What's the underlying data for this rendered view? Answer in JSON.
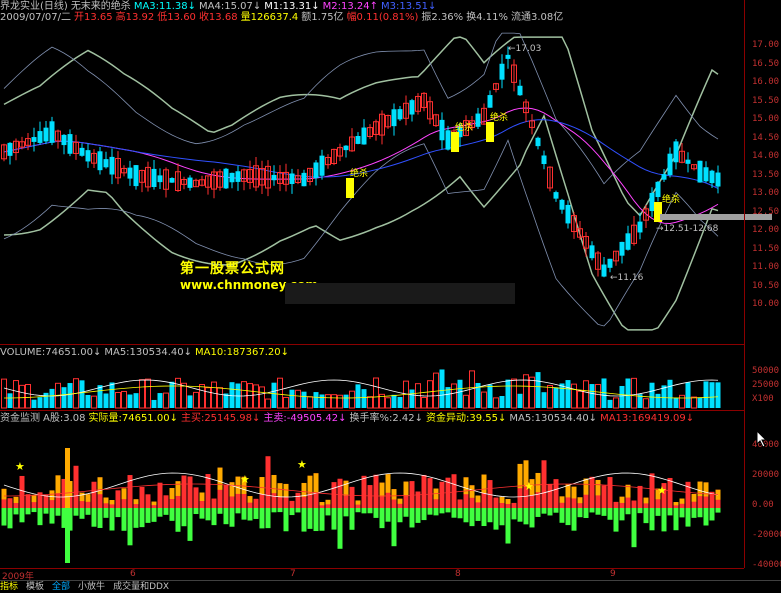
{
  "main_header": {
    "line1": [
      {
        "text": "界龙实业(日线)",
        "color": "#c0c0c0"
      },
      {
        "text": "无末来的绝杀",
        "color": "#c0c0c0"
      },
      {
        "text": "MA3:11.38↓",
        "color": "#00ffff"
      },
      {
        "text": "MA4:15.07↓",
        "color": "#c0c0c0"
      },
      {
        "text": "M1:13.31↓",
        "color": "#ffffff"
      },
      {
        "text": "M2:13.24↑",
        "color": "#ff44ff"
      },
      {
        "text": "M3:13.51↓",
        "color": "#4060ff"
      }
    ],
    "line2": [
      {
        "text": "2009/07/07/二",
        "color": "#c0c0c0"
      },
      {
        "text": "开13.65",
        "color": "#ff3030"
      },
      {
        "text": "高13.92",
        "color": "#ff3030"
      },
      {
        "text": "低13.60",
        "color": "#ff3030"
      },
      {
        "text": "收13.68",
        "color": "#ff3030"
      },
      {
        "text": "量126637.4",
        "color": "#ffff00"
      },
      {
        "text": "额1.75亿",
        "color": "#c0c0c0"
      },
      {
        "text": "幅0.11(0.81%)",
        "color": "#ff3030"
      },
      {
        "text": "振2.36%",
        "color": "#c0c0c0"
      },
      {
        "text": "换4.11%",
        "color": "#c0c0c0"
      },
      {
        "text": "流通3.08亿",
        "color": "#c0c0c0"
      }
    ]
  },
  "price_axis": [
    "17.00",
    "16.50",
    "16.00",
    "15.50",
    "15.00",
    "14.50",
    "14.00",
    "13.50",
    "13.00",
    "12.50",
    "12.00",
    "11.50",
    "11.00",
    "10.50",
    "10.00"
  ],
  "annotations": {
    "high": "17.03",
    "low": "11.16",
    "range": "12.51-12.68",
    "signal": "绝杀"
  },
  "watermark": {
    "line1": "第一股票公式网",
    "line2": "www.chnmoney.com"
  },
  "volume_header": [
    {
      "text": "VOLUME:74651.00↓",
      "color": "#c0c0c0"
    },
    {
      "text": "MA5:130534.40↓",
      "color": "#c0c0c0"
    },
    {
      "text": "MA10:187367.20↓",
      "color": "#ffff00"
    }
  ],
  "volume_axis": [
    "50000",
    "25000",
    "X100"
  ],
  "fund_header": [
    {
      "text": "资金监测",
      "color": "#c0c0c0"
    },
    {
      "text": "A股:3.08",
      "color": "#c0c0c0"
    },
    {
      "text": "实际量:74651.00↓",
      "color": "#ffff00"
    },
    {
      "text": "主买:25145.98↓",
      "color": "#ff3030"
    },
    {
      "text": "主卖:-49505.42↓",
      "color": "#ff44ff"
    },
    {
      "text": "换手率%:2.42↓",
      "color": "#c0c0c0"
    },
    {
      "text": "资金异动:39.55↓",
      "color": "#ffff00"
    },
    {
      "text": "MA5:130534.40↓",
      "color": "#c0c0c0"
    },
    {
      "text": "MA13:169419.09↓",
      "color": "#ff3030"
    }
  ],
  "fund_axis": [
    "40000",
    "20000",
    "0.00",
    "-20000",
    "-40000"
  ],
  "date_axis": [
    {
      "label": "2009年"
    },
    {
      "label": "6"
    },
    {
      "label": "7"
    },
    {
      "label": "8"
    },
    {
      "label": "9"
    }
  ],
  "tabs": [
    {
      "label": "指标",
      "state": "active"
    },
    {
      "label": "模板",
      "state": "normal"
    },
    {
      "label": "全部",
      "state": "blue"
    },
    {
      "label": "小放牛",
      "state": "normal"
    },
    {
      "label": "成交量和DDX",
      "state": "normal"
    }
  ]
}
